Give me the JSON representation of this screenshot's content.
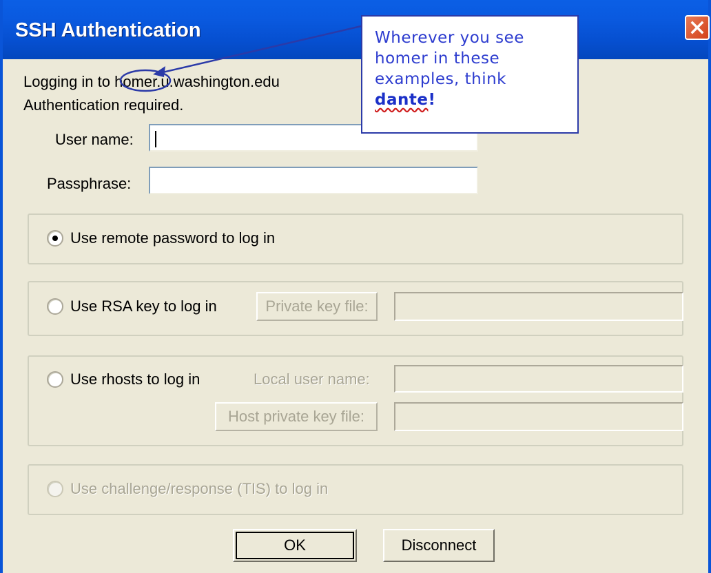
{
  "window": {
    "title": "SSH Authentication"
  },
  "header": {
    "login_prefix": "Logging in to ",
    "host": "homer.u.washington.edu",
    "auth_required": "Authentication required."
  },
  "fields": {
    "username_label": "User name:",
    "username_value": "",
    "passphrase_label": "Passphrase:",
    "passphrase_value": ""
  },
  "options": {
    "remote_password": "Use remote password to log in",
    "rsa": "Use RSA key to log in",
    "private_key_button": "Private key file:",
    "rhosts": "Use rhosts to log in",
    "local_user_label": "Local user name:",
    "host_key_button": "Host private key file:",
    "tis": "Use challenge/response (TIS) to log in",
    "selected": "remote_password"
  },
  "buttons": {
    "ok": "OK",
    "disconnect": "Disconnect"
  },
  "callout": {
    "line1": "Wherever you see",
    "line2": "homer in these",
    "line3": "examples, think",
    "emphasis": "dante",
    "bang": "!"
  },
  "colors": {
    "titlebar": "#0a5ae0",
    "dialog_bg": "#ece9d8",
    "callout_text": "#2d3ccf",
    "annotation": "#2b3aa8"
  }
}
